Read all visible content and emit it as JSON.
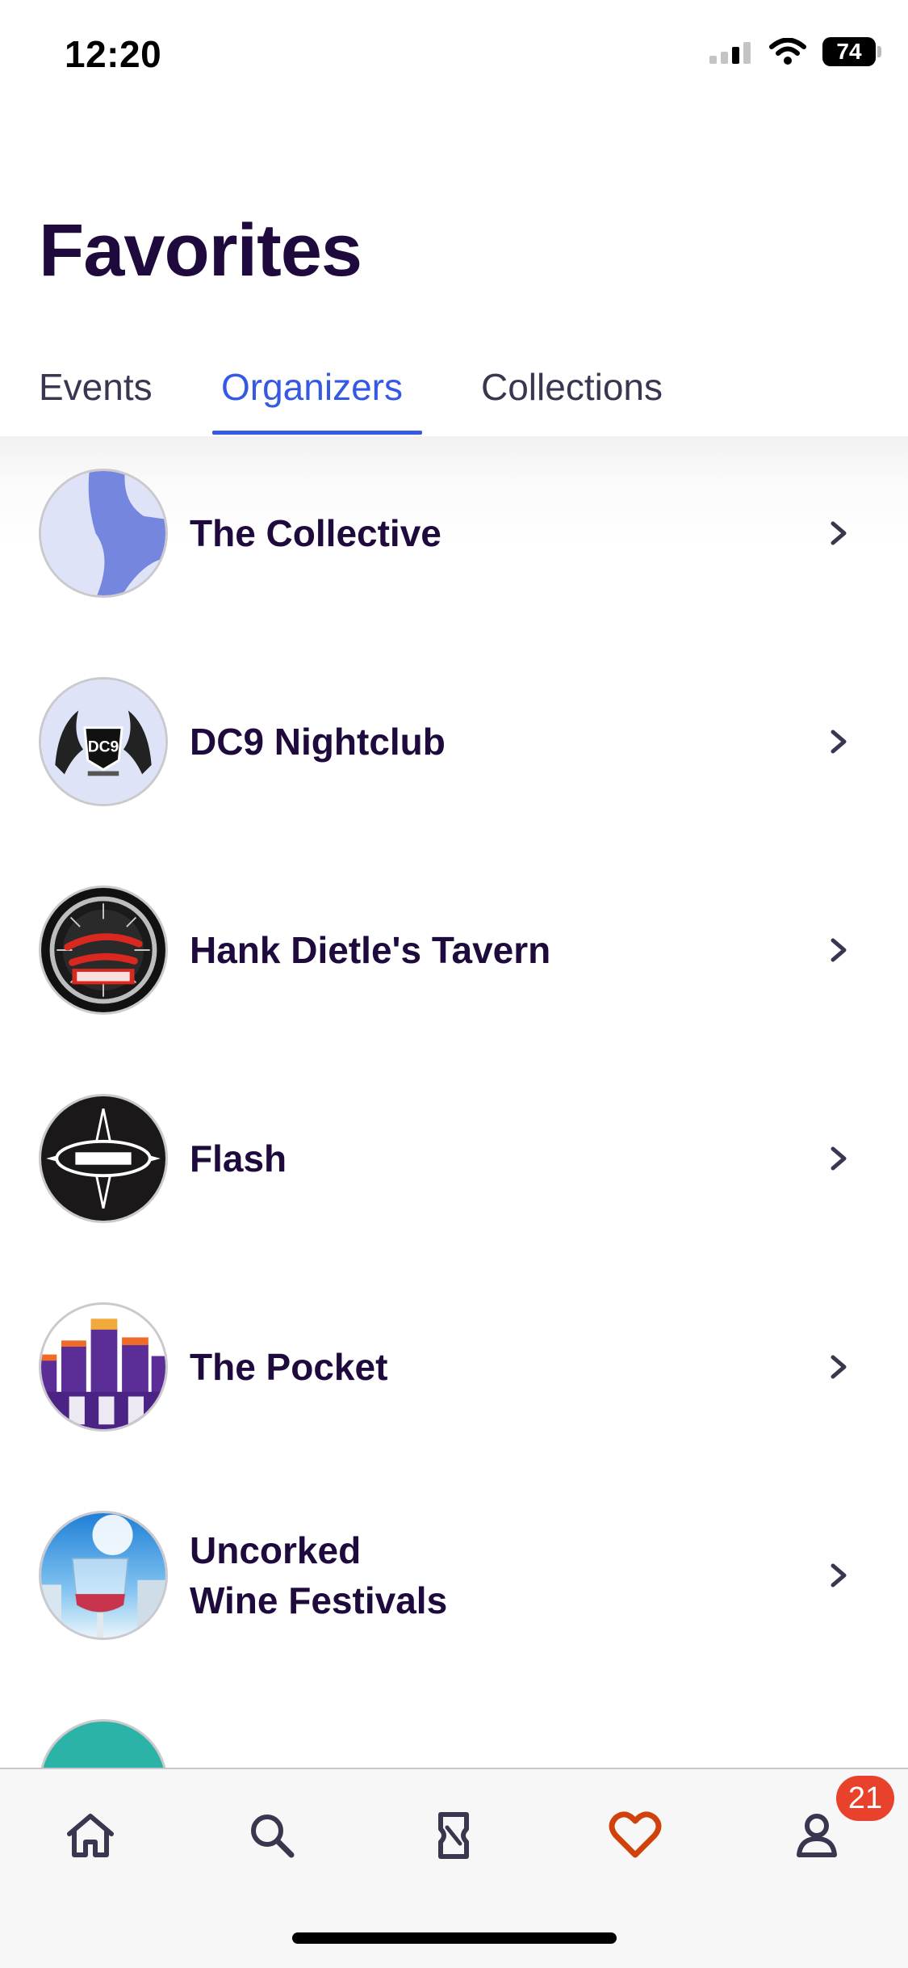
{
  "status_bar": {
    "time": "12:20",
    "battery": "74"
  },
  "header": {
    "title": "Favorites"
  },
  "tabs": [
    {
      "label": "Events",
      "active": false
    },
    {
      "label": "Organizers",
      "active": true
    },
    {
      "label": "Collections",
      "active": false
    }
  ],
  "organizers": [
    {
      "name": "The Collective",
      "avatar": "collective-logo"
    },
    {
      "name": "DC9 Nightclub",
      "avatar": "dc9-logo"
    },
    {
      "name": "Hank Dietle's Tavern",
      "avatar": "hank-dietles-logo"
    },
    {
      "name": "Flash",
      "avatar": "flash-logo"
    },
    {
      "name": "The Pocket",
      "avatar": "pocket-logo"
    },
    {
      "name": "Uncorked\nWine Festivals",
      "avatar": "uncorked-logo"
    }
  ],
  "bottom_nav": {
    "items": [
      {
        "icon": "home-icon"
      },
      {
        "icon": "search-icon"
      },
      {
        "icon": "tickets-icon"
      },
      {
        "icon": "heart-icon",
        "active": true
      },
      {
        "icon": "profile-icon"
      }
    ],
    "badge": "21"
  },
  "colors": {
    "accent": "#3659e3",
    "brand_orange": "#d1410c",
    "badge": "#e8412c",
    "text": "#1e0a3c"
  }
}
